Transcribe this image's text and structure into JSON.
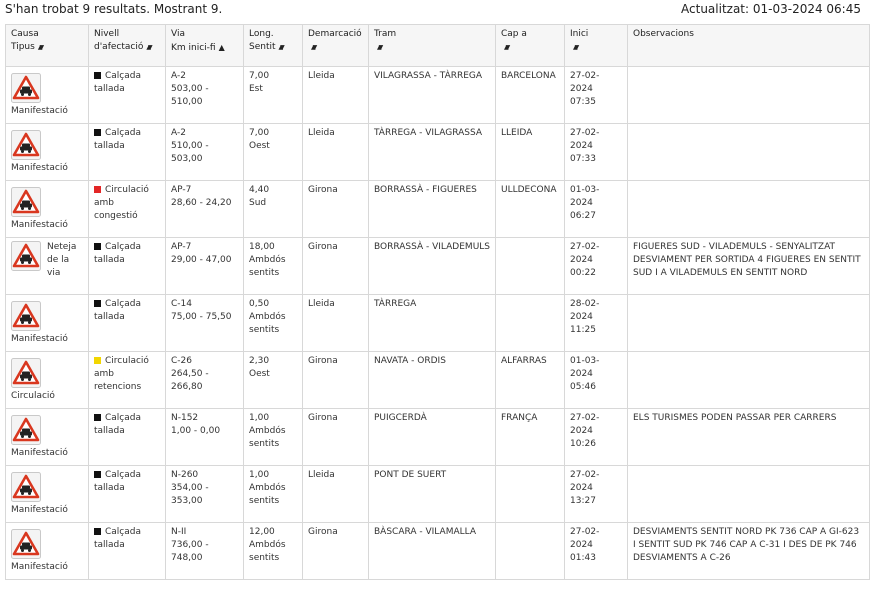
{
  "header": {
    "results_text": "S'han trobat 9 resultats. Mostrant 9.",
    "updated_text": "Actualitzat: 01-03-2024 06:45"
  },
  "columns": [
    {
      "line1": "Causa",
      "line2": "Tipus",
      "sort": "both"
    },
    {
      "line1": "Nivell",
      "line2": "d'afectació",
      "sort": "both"
    },
    {
      "line1": "Via",
      "line2": "Km inici-fi",
      "sort": "up"
    },
    {
      "line1": "Long.",
      "line2": "Sentit",
      "sort": "both"
    },
    {
      "line1": "Demarcació",
      "line2": "",
      "sort": "both"
    },
    {
      "line1": "Tram",
      "line2": "",
      "sort": "both"
    },
    {
      "line1": "Cap a",
      "line2": "",
      "sort": "both"
    },
    {
      "line1": "Inici",
      "line2": "",
      "sort": "both"
    },
    {
      "line1": "Observacions",
      "line2": "",
      "sort": "none"
    }
  ],
  "level_colors": {
    "black": "#111111",
    "red": "#e32626",
    "yellow": "#f2d600"
  },
  "icon": {
    "name": "traffic-warning-sign-icon",
    "border_color": "#d9371f"
  },
  "rows": [
    {
      "cause": "Manifestació",
      "layout": "below",
      "level_color": "black",
      "level1": "Calçada",
      "level2": "tallada",
      "level3": "",
      "road": "A-2",
      "km1": "503,00 -",
      "km2": "510,00",
      "length": "7,00",
      "dir1": "Est",
      "dir2": "",
      "district": "Lleida",
      "section": "VILAGRASSA - TÀRREGA",
      "towards": "BARCELONA",
      "date": "27-02-2024",
      "time": "07:35",
      "obs": ""
    },
    {
      "cause": "Manifestació",
      "layout": "below",
      "level_color": "black",
      "level1": "Calçada",
      "level2": "tallada",
      "level3": "",
      "road": "A-2",
      "km1": "510,00 -",
      "km2": "503,00",
      "length": "7,00",
      "dir1": "Oest",
      "dir2": "",
      "district": "Lleida",
      "section": "TÀRREGA - VILAGRASSA",
      "towards": "LLEIDA",
      "date": "27-02-2024",
      "time": "07:33",
      "obs": ""
    },
    {
      "cause": "Manifestació",
      "layout": "below",
      "level_color": "red",
      "level1": "Circulació",
      "level2": "amb congestió",
      "level3": "",
      "road": "AP-7",
      "km1": "28,60 - 24,20",
      "km2": "",
      "length": "4,40",
      "dir1": "Sud",
      "dir2": "",
      "district": "Girona",
      "section": "BORRASSÀ - FIGUERES",
      "towards": "ULLDECONA",
      "date": "01-03-2024",
      "time": "06:27",
      "obs": ""
    },
    {
      "cause": "Neteja de la via",
      "layout": "side",
      "level_color": "black",
      "level1": "Calçada",
      "level2": "tallada",
      "level3": "",
      "road": "AP-7",
      "km1": "29,00 - 47,00",
      "km2": "",
      "length": "18,00",
      "dir1": "Ambdós",
      "dir2": "sentits",
      "district": "Girona",
      "section": "BORRASSÀ - VILADEMULS",
      "towards": "",
      "date": "27-02-2024",
      "time": "00:22",
      "obs": "FIGUERES SUD - VILADEMULS - SENYALITZAT DESVIAMENT PER SORTIDA 4 FIGUERES EN SENTIT SUD I A VILADEMULS EN SENTIT NORD"
    },
    {
      "cause": "Manifestació",
      "layout": "below",
      "level_color": "black",
      "level1": "Calçada",
      "level2": "tallada",
      "level3": "",
      "road": "C-14",
      "km1": "75,00 - 75,50",
      "km2": "",
      "length": "0,50",
      "dir1": "Ambdós",
      "dir2": "sentits",
      "district": "Lleida",
      "section": "TÀRREGA",
      "towards": "",
      "date": "28-02-2024",
      "time": "11:25",
      "obs": ""
    },
    {
      "cause": "Circulació",
      "layout": "below",
      "level_color": "yellow",
      "level1": "Circulació",
      "level2": "amb",
      "level3": "retencions",
      "road": "C-26",
      "km1": "264,50 -",
      "km2": "266,80",
      "length": "2,30",
      "dir1": "Oest",
      "dir2": "",
      "district": "Girona",
      "section": "NAVATA - ORDIS",
      "towards": "ALFARRAS",
      "date": "01-03-2024",
      "time": "05:46",
      "obs": ""
    },
    {
      "cause": "Manifestació",
      "layout": "below",
      "level_color": "black",
      "level1": "Calçada",
      "level2": "tallada",
      "level3": "",
      "road": "N-152",
      "km1": "1,00 - 0,00",
      "km2": "",
      "length": "1,00",
      "dir1": "Ambdós",
      "dir2": "sentits",
      "district": "Girona",
      "section": "PUIGCERDÀ",
      "towards": "FRANÇA",
      "date": "27-02-2024",
      "time": "10:26",
      "obs": "ELS TURISMES PODEN PASSAR PER CARRERS"
    },
    {
      "cause": "Manifestació",
      "layout": "below",
      "level_color": "black",
      "level1": "Calçada",
      "level2": "tallada",
      "level3": "",
      "road": "N-260",
      "km1": "354,00 -",
      "km2": "353,00",
      "length": "1,00",
      "dir1": "Ambdós",
      "dir2": "sentits",
      "district": "Lleida",
      "section": "PONT DE SUERT",
      "towards": "",
      "date": "27-02-2024",
      "time": "13:27",
      "obs": ""
    },
    {
      "cause": "Manifestació",
      "layout": "below",
      "level_color": "black",
      "level1": "Calçada",
      "level2": "tallada",
      "level3": "",
      "road": "N-II",
      "km1": "736,00 -",
      "km2": "748,00",
      "length": "12,00",
      "dir1": "Ambdós",
      "dir2": "sentits",
      "district": "Girona",
      "section": "BÀSCARA - VILAMALLA",
      "towards": "",
      "date": "27-02-2024",
      "time": "01:43",
      "obs": "DESVIAMENTS SENTIT NORD PK 736 CAP A GI-623 I SENTIT SUD PK 746 CAP A C-31 I DES DE PK 746 DESVIAMENTS A C-26"
    }
  ]
}
